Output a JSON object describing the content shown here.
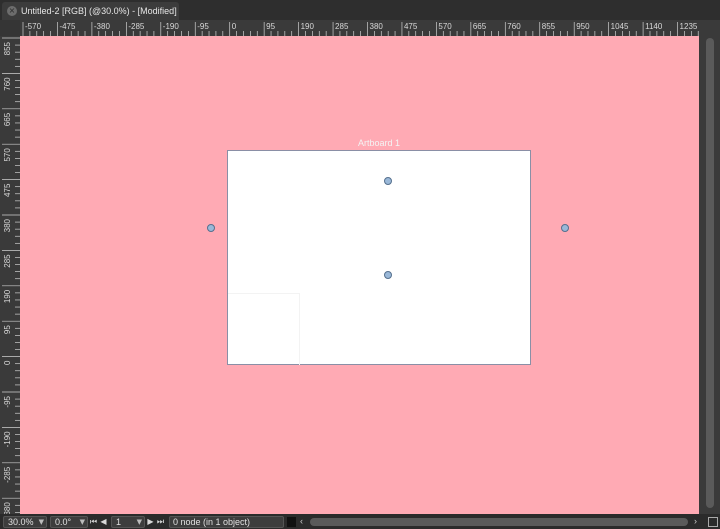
{
  "tab": {
    "title": "Untitled-2 [RGB] (@30.0%) - [Modified]",
    "close_icon": "close-icon"
  },
  "rulers": {
    "horizontal_labels": [
      "-570",
      "-475",
      "-380",
      "-285",
      "-190",
      "-95",
      "0",
      "95",
      "190",
      "285",
      "380",
      "475",
      "570",
      "665",
      "760",
      "855",
      "950",
      "1045",
      "1140",
      "1235"
    ],
    "vertical_labels": [
      "855",
      "760",
      "665",
      "570",
      "475",
      "380",
      "285",
      "190",
      "95",
      "0",
      "-95",
      "-190",
      "-285",
      "-380"
    ]
  },
  "canvas": {
    "background_color": "#ffaab4",
    "artboard_label": "Artboard 1",
    "artboard_color": "#ffffff"
  },
  "statusbar": {
    "zoom": "30.0%",
    "rotation": "0.0°",
    "page": "1",
    "status": "0 node (in 1 object)",
    "first_page_icon": "first-page-icon",
    "prev_page_icon": "prev-page-icon",
    "next_page_icon": "next-page-icon",
    "last_page_icon": "last-page-icon"
  },
  "colors": {
    "handle_fill": "#9ab8d8",
    "ui_dark": "#2b2b2b"
  }
}
